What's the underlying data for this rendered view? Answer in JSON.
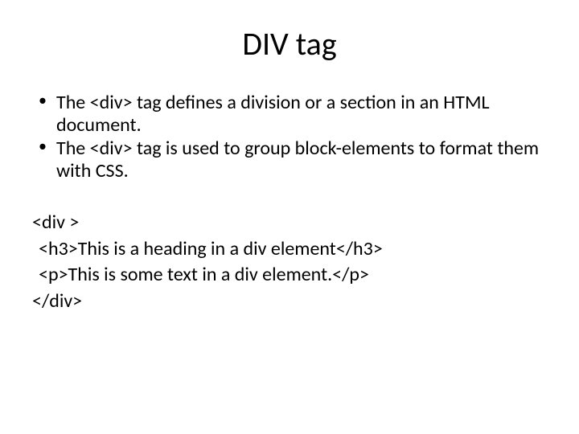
{
  "title": "DIV tag",
  "bullets": [
    "The <div> tag defines a division or a section in an HTML document.",
    "The <div> tag is used to group block-elements to format them with CSS."
  ],
  "code": {
    "line1": "<div >",
    "line2": "<h3>This is a heading in a div element</h3>",
    "line3": "<p>This is some text in a div element.</p>",
    "line4": "</div>"
  }
}
